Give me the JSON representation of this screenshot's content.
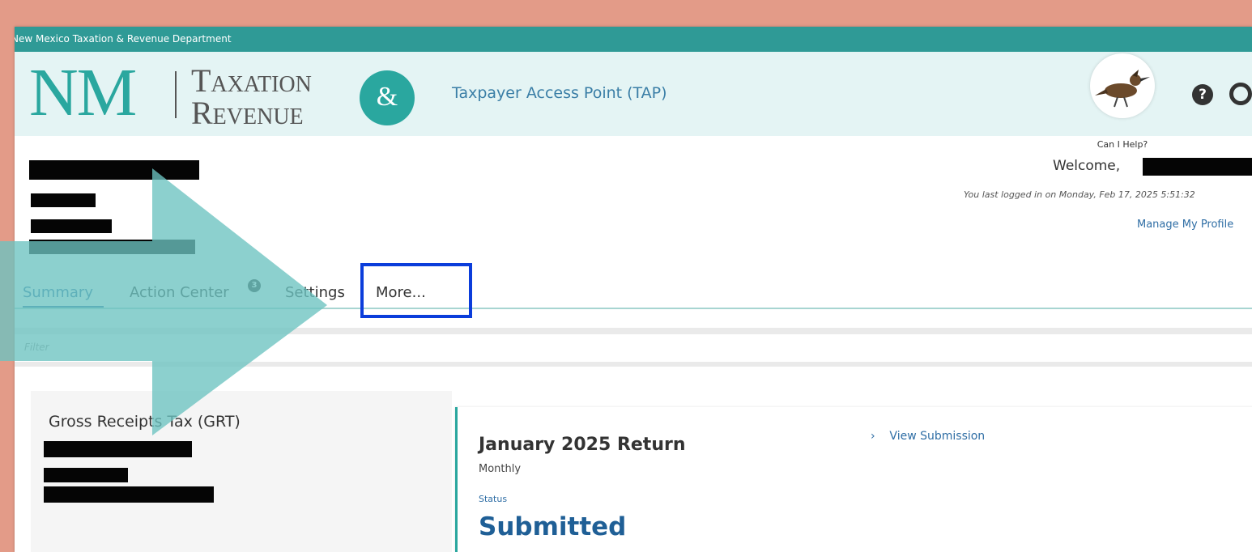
{
  "agency_bar": {
    "text": "New Mexico Taxation & Revenue Department"
  },
  "logo": {
    "nm": "NM",
    "line1": "Taxation",
    "line2": "Revenue",
    "amp": "&"
  },
  "header": {
    "app_title": "Taxpayer Access Point (TAP)",
    "help_caption": "Can I Help?",
    "help_icon": "?"
  },
  "account": {
    "welcome": "Welcome,",
    "last_login": "You last logged in on Monday, Feb 17, 2025 5:51:32",
    "manage_profile": "Manage My Profile"
  },
  "tabs": [
    {
      "label": "Summary",
      "active": true
    },
    {
      "label": "Action Center",
      "badge": "3"
    },
    {
      "label": "Settings"
    },
    {
      "label": "More..."
    }
  ],
  "filter": {
    "placeholder": "Filter"
  },
  "grt": {
    "title": "Gross Receipts Tax (GRT)",
    "return_title": "January 2025 Return",
    "period": "Monthly",
    "status_label": "Status",
    "status": "Submitted",
    "view_link": "View Submission",
    "link_icon": "chevron-right-icon"
  },
  "colors": {
    "teal": "#2aa79f",
    "topbar": "#2f9a96",
    "link_blue": "#2f6ea5",
    "highlight_box": "#0b3ddb",
    "background": "#e39b88",
    "arrow": "#6cc3c0"
  }
}
